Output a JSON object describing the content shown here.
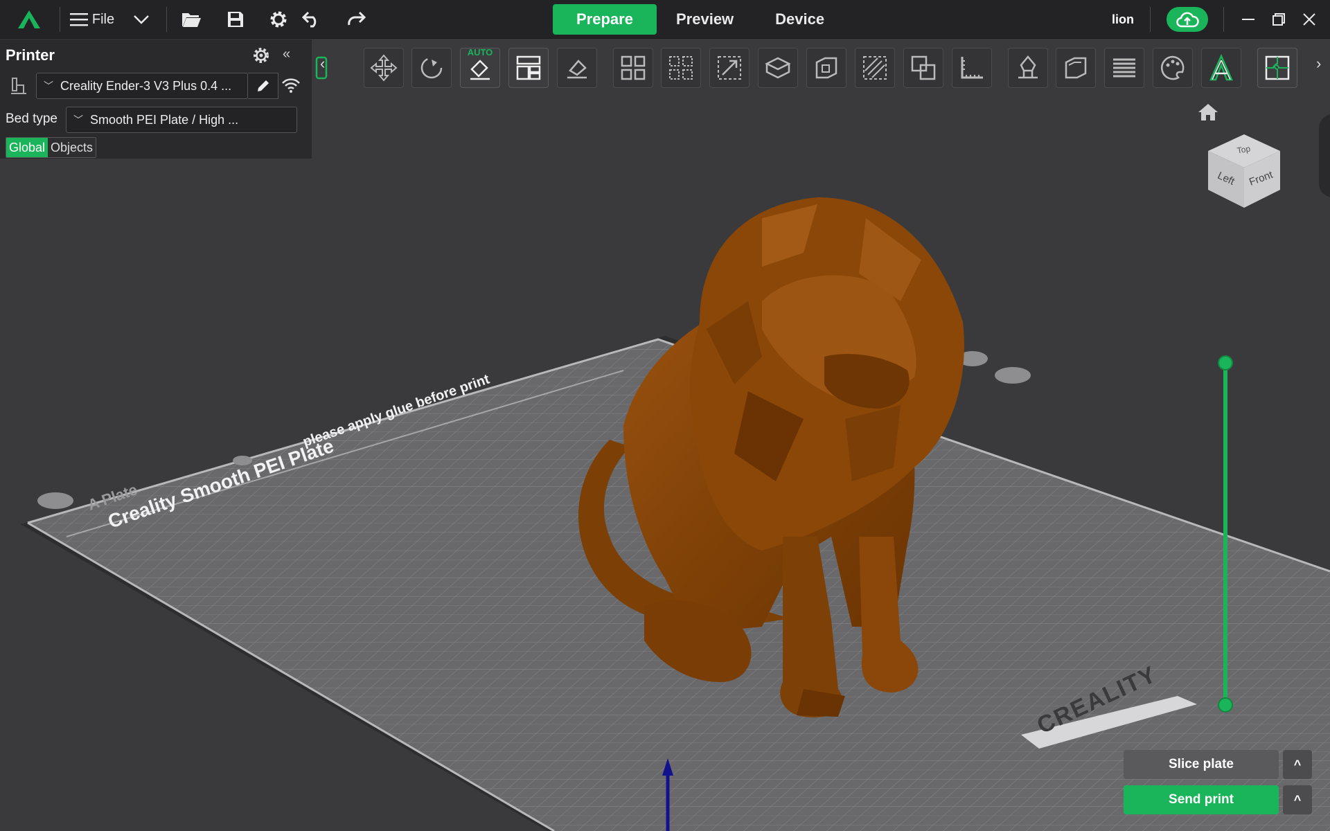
{
  "app": {
    "file_label": "File",
    "username": "lion"
  },
  "tabs": [
    {
      "label": "Prepare",
      "active": true
    },
    {
      "label": "Preview",
      "active": false
    },
    {
      "label": "Device",
      "active": false
    }
  ],
  "printer_panel": {
    "title": "Printer",
    "printer_name": "Creality Ender-3 V3 Plus 0.4 ...",
    "bed_type_label": "Bed type",
    "bed_type_value": "Smooth PEI Plate / High ...",
    "scope_options": [
      "Global",
      "Objects"
    ],
    "scope_selected": "Global"
  },
  "toolbar": {
    "auto_label": "AUTO",
    "tools": [
      "add-icon",
      "move-icon",
      "rotate-icon",
      "auto-orient-icon",
      "arrange-icon",
      "lay-on-face-icon",
      "split-objects-icon",
      "split-parts-icon",
      "scale-icon",
      "variable-layer-icon",
      "cut-icon",
      "support-paint-icon",
      "boolean-icon",
      "measure-icon",
      "seam-paint-icon",
      "hollow-icon",
      "layer-icon",
      "color-paint-icon",
      "text-icon",
      "assembly-icon"
    ]
  },
  "plate": {
    "name": "Creality Smooth PEI Plate",
    "hint": "please apply glue before print",
    "plate_label": "A Plate",
    "brand": "CREALITY"
  },
  "navcube": {
    "top": "Top",
    "left": "Left",
    "front": "Front"
  },
  "actions": {
    "slice_label": "Slice plate",
    "send_label": "Send print",
    "expand_label": "^"
  },
  "colors": {
    "accent": "#1ab55b",
    "model": "#8a4708",
    "background": "#3a3a3c"
  }
}
